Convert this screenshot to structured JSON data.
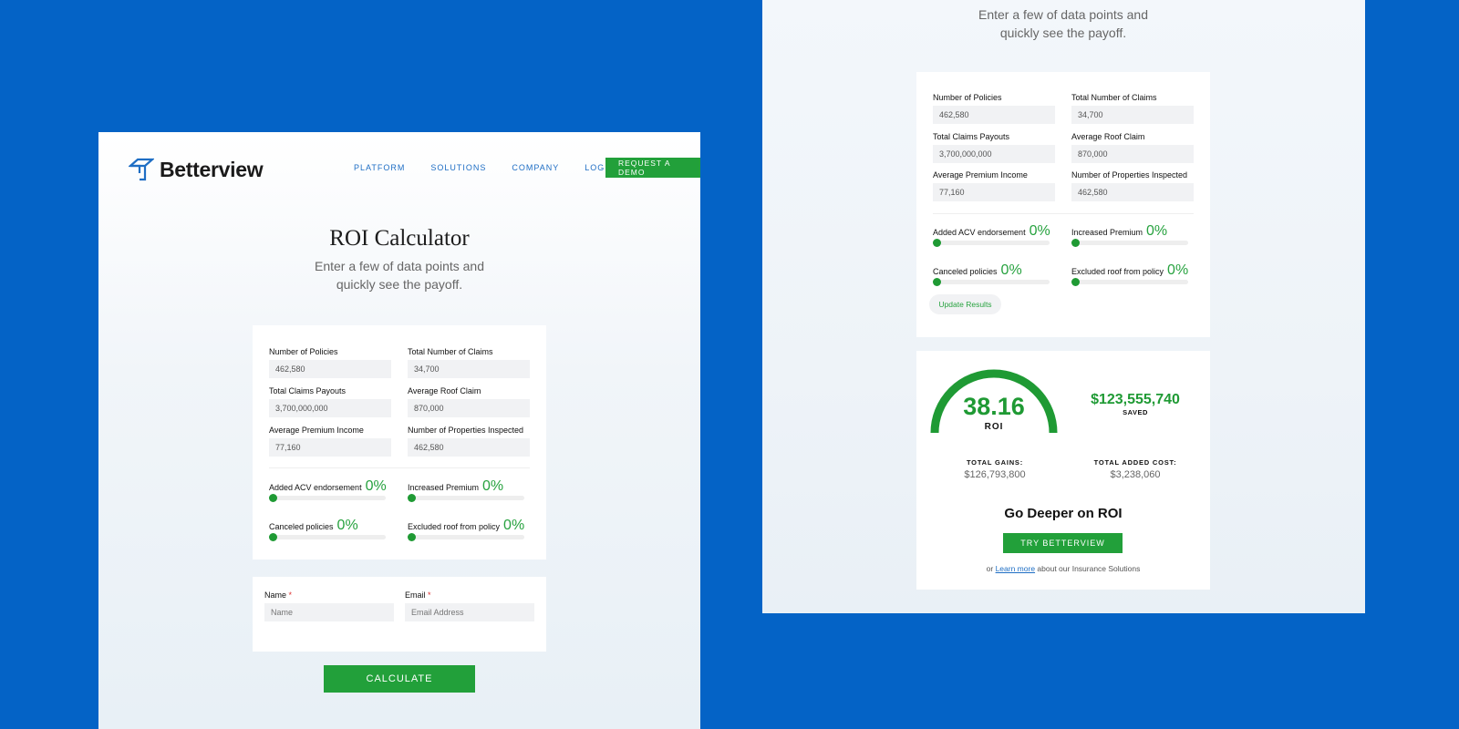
{
  "left": {
    "logo_text": "Betterview",
    "nav": [
      "PLATFORM",
      "SOLUTIONS",
      "COMPANY",
      "LOGIN"
    ],
    "demo_button": "REQUEST A DEMO",
    "title": "ROI Calculator",
    "subtitle": "Enter a few of data points and quickly see the payoff.",
    "fields": [
      {
        "label": "Number of Policies",
        "value": "462,580"
      },
      {
        "label": "Total Number of Claims",
        "value": "34,700"
      },
      {
        "label": "Total Claims Payouts",
        "value": "3,700,000,000"
      },
      {
        "label": "Average Roof Claim",
        "value": "870,000"
      },
      {
        "label": "Average Premium Income",
        "value": "77,160"
      },
      {
        "label": "Number of Properties Inspected",
        "value": "462,580"
      }
    ],
    "sliders": [
      {
        "label": "Added ACV endorsement",
        "pct": "0%",
        "value": 0
      },
      {
        "label": "Increased Premium",
        "pct": "0%",
        "value": 0
      },
      {
        "label": "Canceled policies",
        "pct": "0%",
        "value": 0
      },
      {
        "label": "Excluded roof from policy",
        "pct": "0%",
        "value": 0
      }
    ],
    "contact": {
      "name_label": "Name",
      "name_placeholder": "Name",
      "email_label": "Email",
      "email_placeholder": "Email Address",
      "required_mark": "*"
    },
    "calculate_button": "CALCULATE"
  },
  "right": {
    "subtitle": "Enter a few of data points and quickly see the payoff.",
    "fields": [
      {
        "label": "Number of Policies",
        "value": "462,580"
      },
      {
        "label": "Total Number of Claims",
        "value": "34,700"
      },
      {
        "label": "Total Claims Payouts",
        "value": "3,700,000,000"
      },
      {
        "label": "Average Roof Claim",
        "value": "870,000"
      },
      {
        "label": "Average Premium Income",
        "value": "77,160"
      },
      {
        "label": "Number of Properties Inspected",
        "value": "462,580"
      }
    ],
    "sliders": [
      {
        "label": "Added ACV endorsement",
        "pct": "0%",
        "value": 0
      },
      {
        "label": "Increased Premium",
        "pct": "0%",
        "value": 0
      },
      {
        "label": "Canceled policies",
        "pct": "0%",
        "value": 0
      },
      {
        "label": "Excluded roof from policy",
        "pct": "0%",
        "value": 0
      }
    ],
    "update_button": "Update Results",
    "roi_value": "38.16",
    "roi_label": "ROI",
    "saved_amount": "$123,555,740",
    "saved_label": "SAVED",
    "total_gains_label": "TOTAL GAINS:",
    "total_gains_value": "$126,793,800",
    "total_cost_label": "TOTAL ADDED COST:",
    "total_cost_value": "$3,238,060",
    "deeper_title": "Go Deeper on ROI",
    "try_button": "TRY BETTERVIEW",
    "footer_prefix": "or",
    "footer_link": "Learn more",
    "footer_suffix": "about our Insurance Solutions"
  },
  "colors": {
    "background": "#0463c6",
    "accent_green": "#22a03a",
    "link_blue": "#1e6ec4"
  }
}
